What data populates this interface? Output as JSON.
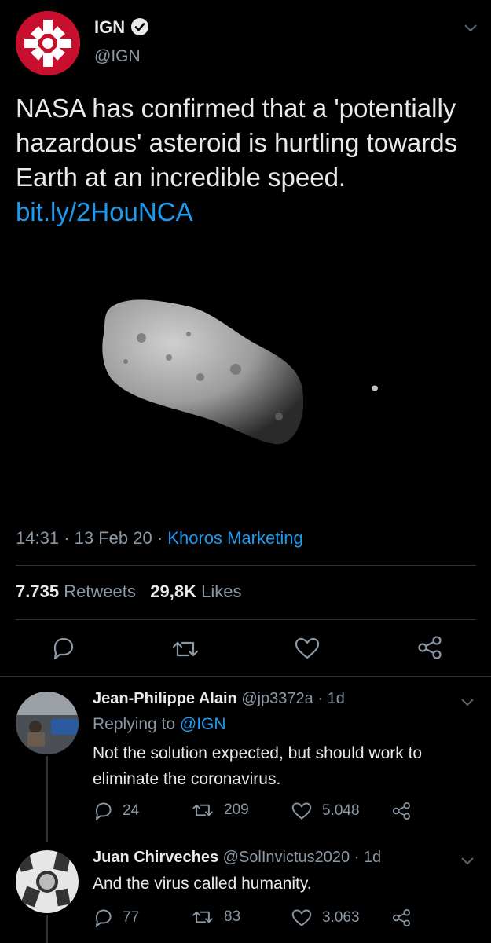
{
  "tweet": {
    "author_name": "IGN",
    "author_handle": "@IGN",
    "text": "NASA has confirmed that a 'potentially hazardous' asteroid is hurtling towards Earth at an incredible speed.",
    "link": "bit.ly/2HouNCA",
    "time": "14:31",
    "date": "13 Feb 20",
    "separator": "·",
    "source": "Khoros Marketing",
    "retweets_count": "7.735",
    "retweets_label": "Retweets",
    "likes_count": "29,8K",
    "likes_label": "Likes"
  },
  "replies": [
    {
      "name": "Jean-Philippe Alain",
      "handle": "@jp3372a",
      "time": "· 1d",
      "replying_label": "Replying to",
      "replying_to": "@IGN",
      "text": "Not the solution expected, but should work to eliminate the coronavirus.",
      "reply_count": "24",
      "retweet_count": "209",
      "like_count": "5.048"
    },
    {
      "name": "Juan Chirveches",
      "handle": "@SolInvictus2020",
      "time": "· 1d",
      "text": "And the virus called humanity.",
      "reply_count": "77",
      "retweet_count": "83",
      "like_count": "3.063"
    }
  ],
  "icons": {
    "verified": "verified-badge-icon",
    "chevron": "chevron-down-icon",
    "reply": "reply-icon",
    "retweet": "retweet-icon",
    "like": "heart-icon",
    "share": "share-icon"
  },
  "colors": {
    "background": "#000000",
    "link": "#1d9bf0",
    "muted": "#8b98a5",
    "ign_red": "#c8102e"
  }
}
